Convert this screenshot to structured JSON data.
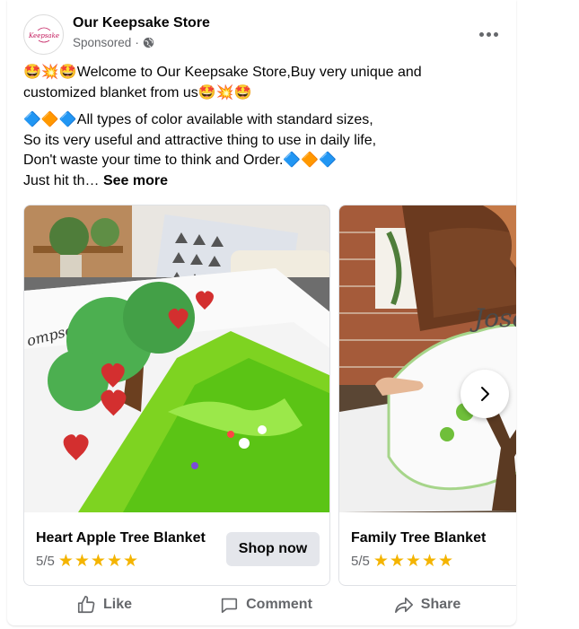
{
  "post": {
    "page_name": "Our Keepsake Store",
    "sponsored_label": "Sponsored",
    "sponsored_sep": "·",
    "avatar_text": "Keepsake",
    "text": {
      "p1_line1": "🤩💥🤩Welcome to Our Keepsake Store,Buy very unique and",
      "p1_line2": "customized blanket from us🤩💥🤩",
      "p2_line1": "🔷🔶🔷All types of color available with standard sizes,",
      "p2_line2": "So its very useful and attractive thing to use in daily life,",
      "p2_line3": "Don't waste your time to think and Order.🔷🔶🔷",
      "p2_line4": "Just hit th…",
      "see_more": "See more"
    }
  },
  "carousel": {
    "cards": [
      {
        "title": "Heart Apple Tree Blanket",
        "rating": "5/5",
        "stars": "★★★★★",
        "cta": "Shop now",
        "image_text": "ompsons Family"
      },
      {
        "title": "Family Tree Blanket",
        "rating": "5/5",
        "stars": "★★★★★",
        "image_text": "Joseph"
      }
    ]
  },
  "actions": {
    "like": "Like",
    "comment": "Comment",
    "share": "Share"
  },
  "colors": {
    "text_primary": "#050505",
    "text_secondary": "#65676b",
    "button_bg": "#e4e6eb",
    "star": "#f4b400"
  },
  "icons": {
    "more": "more-horizontal-icon",
    "globe": "globe-icon",
    "next": "chevron-right-icon",
    "like": "thumbs-up-icon",
    "comment": "comment-bubble-icon",
    "share": "share-arrow-icon"
  }
}
